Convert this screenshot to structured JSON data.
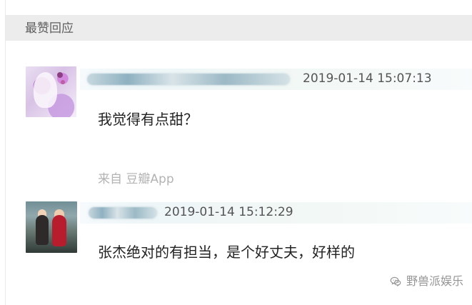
{
  "section": {
    "title": "最赞回应"
  },
  "comments": [
    {
      "timestamp": "2019-01-14 15:07:13",
      "text": "我觉得有点甜？",
      "source": "来自 豆瓣App"
    },
    {
      "timestamp": "2019-01-14 15:12:29",
      "text": "张杰绝对的有担当，是个好丈夫，好样的"
    }
  ],
  "watermark": {
    "text": "野兽派娱乐",
    "icon": "wechat-icon"
  }
}
